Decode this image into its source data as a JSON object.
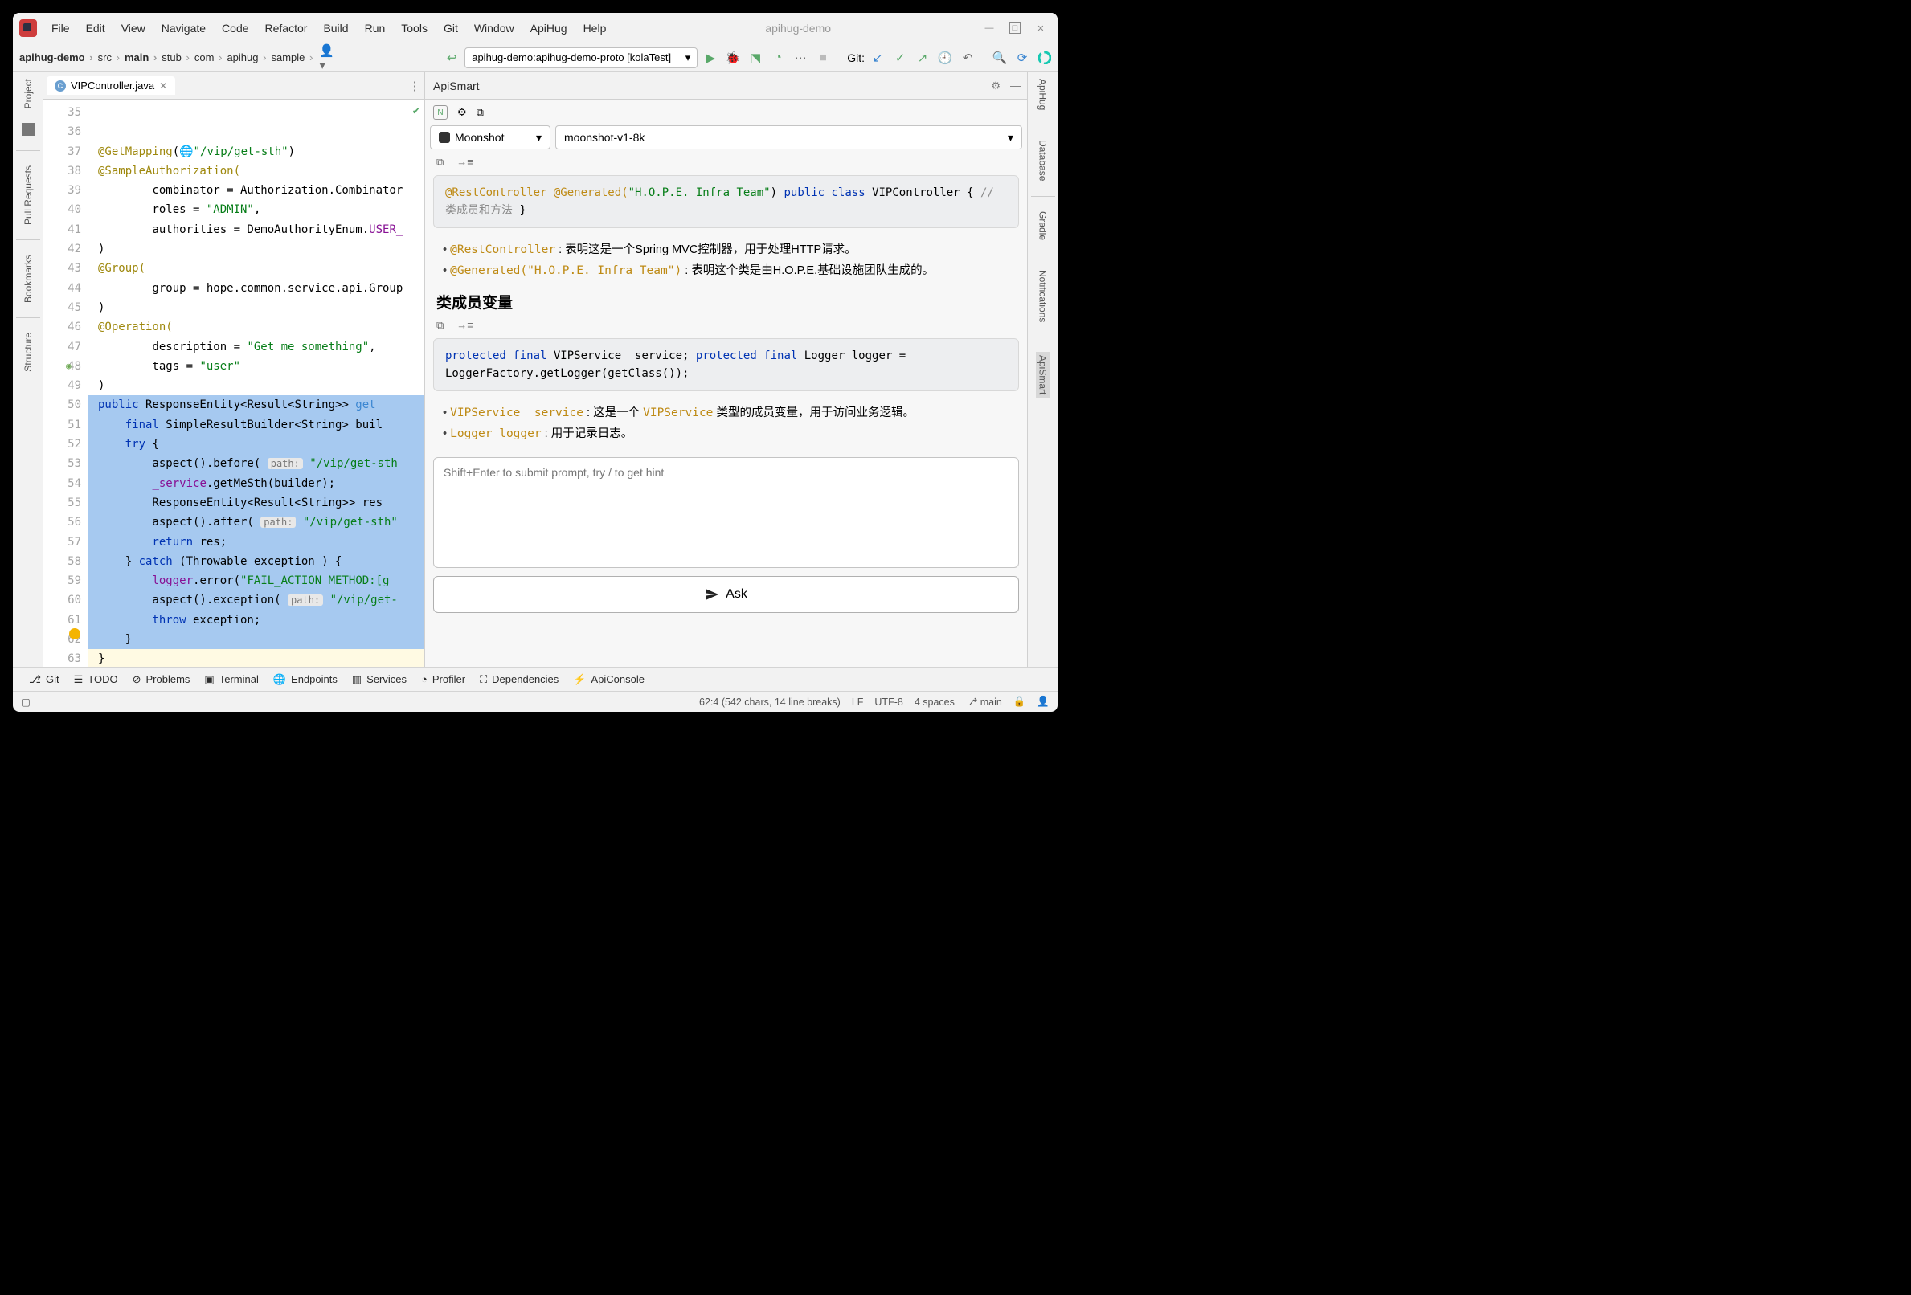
{
  "window": {
    "title": "apihug-demo"
  },
  "menu": {
    "file": "File",
    "edit": "Edit",
    "view": "View",
    "navigate": "Navigate",
    "code": "Code",
    "refactor": "Refactor",
    "build": "Build",
    "run": "Run",
    "tools": "Tools",
    "git": "Git",
    "window": "Window",
    "apihug": "ApiHug",
    "help": "Help"
  },
  "breadcrumbs": {
    "b0": "apihug-demo",
    "b1": "src",
    "b2": "main",
    "b3": "stub",
    "b4": "com",
    "b5": "apihug",
    "b6": "sample"
  },
  "runConfig": {
    "label": "apihug-demo:apihug-demo-proto [kolaTest]"
  },
  "gitLabel": "Git:",
  "editorTab": {
    "name": "VIPController.java"
  },
  "smartTab": {
    "name": "ApiSmart"
  },
  "lineNumbers": [
    "35",
    "36",
    "37",
    "38",
    "39",
    "40",
    "41",
    "42",
    "43",
    "44",
    "45",
    "46",
    "47",
    "48",
    "49",
    "50",
    "51",
    "52",
    "53",
    "54",
    "55",
    "56",
    "57",
    "58",
    "59",
    "60",
    "61",
    "62",
    "63"
  ],
  "code": {
    "l35_ann": "@GetMapping",
    "l35_par": "(",
    "l35_path": "\"/vip/get-sth\"",
    "l35_close": ")",
    "l36": "@SampleAuthorization(",
    "l37a": "        combinator = Authorization.Combinator",
    "l38a": "        roles = ",
    "l38b": "\"ADMIN\"",
    "l38c": ",",
    "l39a": "        authorities = DemoAuthorityEnum.",
    "l39b": "USER_",
    "l40": ")",
    "l41": "@Group(",
    "l42": "        group = hope.common.service.api.Group",
    "l43": ")",
    "l44": "@Operation(",
    "l45a": "        description = ",
    "l45b": "\"Get me something\"",
    "l45c": ",",
    "l46a": "        tags = ",
    "l46b": "\"user\"",
    "l47": ")",
    "l48a": "public",
    "l48b": " ResponseEntity<Result<String>> ",
    "l48c": "get",
    "l49a": "    final",
    "l49b": " SimpleResultBuilder<String> buil",
    "l50": "",
    "l51a": "    try",
    "l51b": " {",
    "l52a": "        aspect().before( ",
    "l52p": "path:",
    "l52b": " \"/vip/get-sth",
    "l53a": "        ",
    "l53b": "_service",
    "l53c": ".getMeSth(builder);",
    "l54": "        ResponseEntity<Result<String>> res",
    "l55a": "        aspect().after( ",
    "l55p": "path:",
    "l55b": " \"/vip/get-sth\"",
    "l56a": "        return",
    "l56b": " res;",
    "l57a": "    } ",
    "l57b": "catch",
    "l57c": " (Throwable exception ) {",
    "l58a": "        ",
    "l58b": "logger",
    "l58c": ".error(",
    "l58d": "\"FAIL_ACTION METHOD:[g",
    "l59a": "        aspect().exception( ",
    "l59p": "path:",
    "l59b": " \"/vip/get-",
    "l60a": "        throw",
    "l60b": " exception;",
    "l61": "    }",
    "l62": "}"
  },
  "apismart": {
    "model_provider": "Moonshot",
    "model_name": "moonshot-v1-8k",
    "snippet1": {
      "l1": "@RestController",
      "l2a": "@Generated(",
      "l2b": "\"H.O.P.E. Infra Team\"",
      "l2c": ")",
      "l3a": "public class",
      "l3b": " VIPController {",
      "l4": "    // 类成员和方法",
      "l5": "}"
    },
    "bullets1": {
      "b1a": "@RestController",
      "b1b": " :  表明这是一个Spring MVC控制器，用于处理HTTP请求。",
      "b2a": "@Generated(\"H.O.P.E. Infra Team\")",
      "b2b": " :  表明这个类是由H.O.P.E.基础设施团队生成的。"
    },
    "h1": "类成员变量",
    "snippet2": {
      "l1a": "protected final",
      "l1b": " VIPService _service;",
      "l2a": "protected final",
      "l2b": " Logger logger = LoggerFactory.getLogger(getClass());"
    },
    "bullets2": {
      "b1a": "VIPService _service",
      "b1b": " :  这是一个 ",
      "b1c": "VIPService",
      "b1d": " 类型的成员变量，用于访问业务逻辑。",
      "b2a": "Logger logger",
      "b2b": " :  用于记录日志。"
    },
    "input_placeholder": "Shift+Enter to submit prompt, try / to get hint",
    "ask_label": "Ask"
  },
  "leftTools": {
    "project": "Project",
    "pulls": "Pull Requests",
    "bookmarks": "Bookmarks",
    "structure": "Structure"
  },
  "rightTools": {
    "apihug": "ApiHug",
    "database": "Database",
    "gradle": "Gradle",
    "notifications": "Notifications",
    "apismart": "ApiSmart"
  },
  "bottomTools": {
    "git": "Git",
    "todo": "TODO",
    "problems": "Problems",
    "terminal": "Terminal",
    "endpoints": "Endpoints",
    "services": "Services",
    "profiler": "Profiler",
    "dependencies": "Dependencies",
    "apiconsole": "ApiConsole"
  },
  "statusbar": {
    "pos": "62:4 (542 chars, 14 line breaks)",
    "eol": "LF",
    "enc": "UTF-8",
    "indent": "4 spaces",
    "branch": "main"
  }
}
